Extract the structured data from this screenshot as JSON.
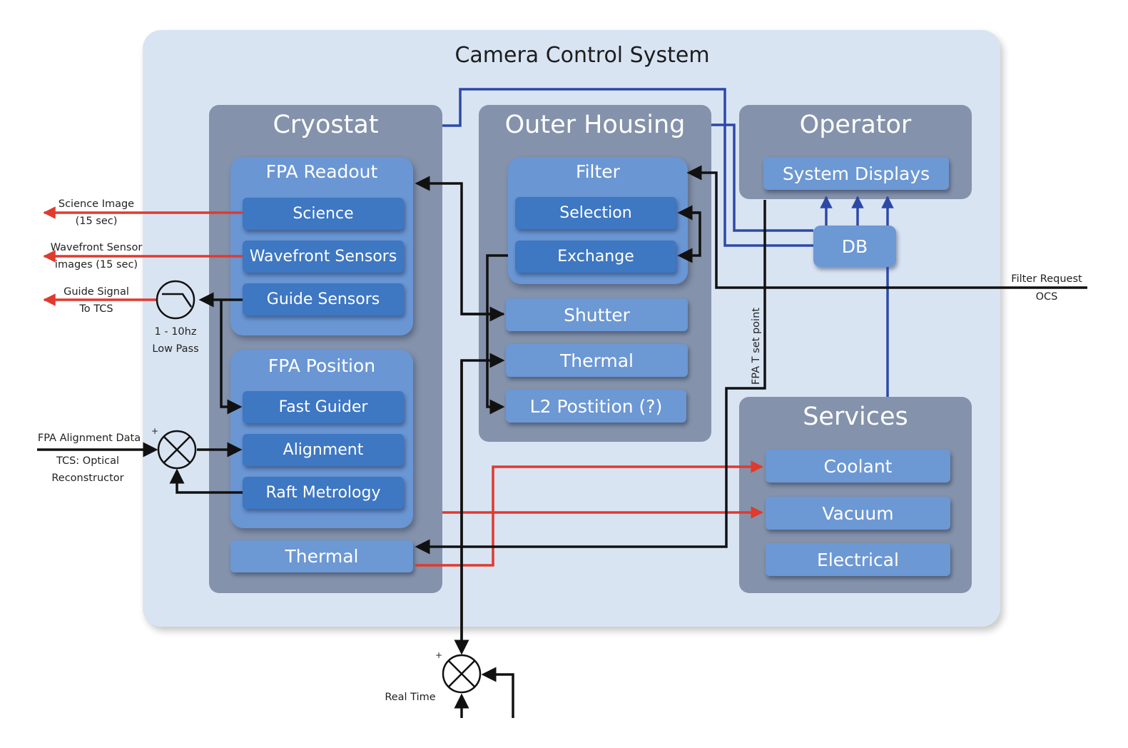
{
  "title": "Camera Control  System",
  "groups": {
    "cryostat": {
      "title": "Cryostat",
      "fpa_readout": {
        "title": "FPA Readout",
        "items": [
          "Science",
          "Wavefront Sensors",
          "Guide Sensors"
        ]
      },
      "fpa_position": {
        "title": "FPA Position",
        "items": [
          "Fast Guider",
          "Alignment",
          "Raft Metrology"
        ]
      },
      "thermal": "Thermal"
    },
    "outer_housing": {
      "title": "Outer Housing",
      "filter": {
        "title": "Filter",
        "items": [
          "Selection",
          "Exchange"
        ]
      },
      "items": [
        "Shutter",
        "Thermal",
        "L2 Postition (?)"
      ]
    },
    "operator": {
      "title": "Operator",
      "items": [
        "System Displays"
      ]
    },
    "db": "DB",
    "services": {
      "title": "Services",
      "items": [
        "Coolant",
        "Vacuum",
        "Electrical"
      ]
    }
  },
  "external_labels": {
    "science_image": [
      "Science Image",
      "(15 sec)"
    ],
    "wavefront": [
      "Wavefront Sensor",
      "images (15 sec)"
    ],
    "guide_signal": [
      "Guide Signal",
      "To TCS"
    ],
    "low_pass": [
      "1 - 10hz",
      "Low Pass"
    ],
    "fpa_alignment": "FPA Alignment Data",
    "tcs_optical": [
      "TCS: Optical",
      "Reconstructor"
    ],
    "filter_request": "Filter Request",
    "ocs": "OCS",
    "fpa_t_set_point": "FPA T set point",
    "real_time": "Real Time",
    "plus_sign": "+"
  },
  "colors": {
    "red_signal": "#e03a2e",
    "blue_link": "#2d49a6",
    "black_control": "#111111"
  }
}
